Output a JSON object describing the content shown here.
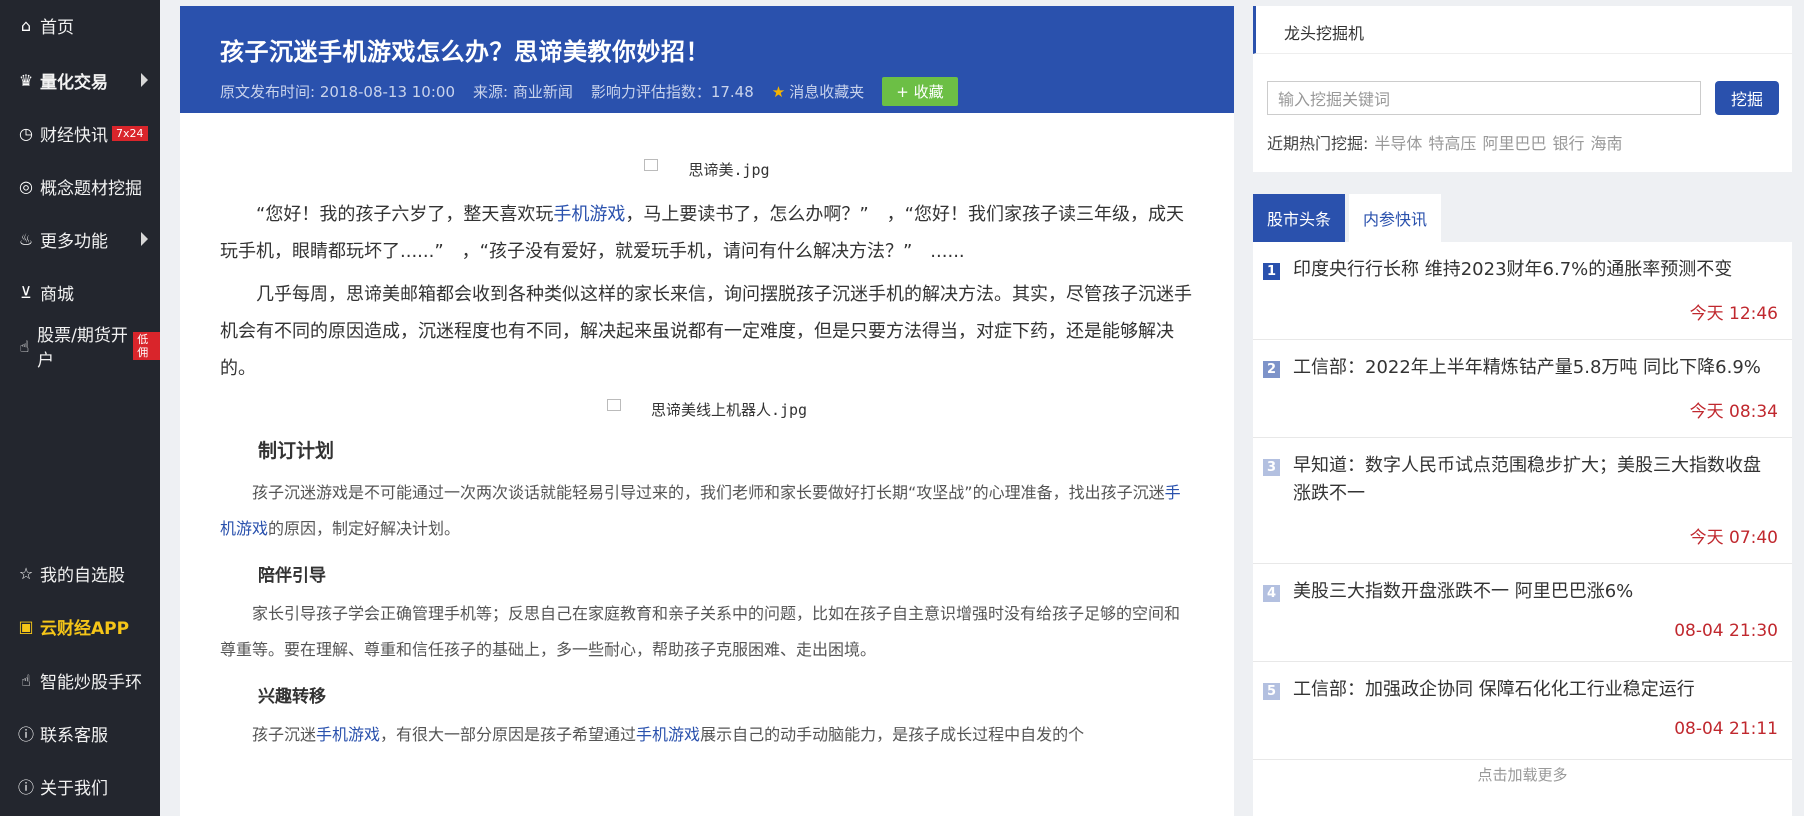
{
  "sidebar": {
    "items": [
      {
        "label": "首页",
        "icon": "home-icon",
        "glyph": "⌂"
      },
      {
        "label": "量化交易",
        "icon": "crown-icon",
        "glyph": "♛"
      },
      {
        "label": "财经快讯",
        "icon": "clock-icon",
        "glyph": "◷",
        "badge": "7x24"
      },
      {
        "label": "概念题材挖掘",
        "icon": "target-icon",
        "glyph": "◎"
      },
      {
        "label": "更多功能",
        "icon": "fire-icon",
        "glyph": "♨"
      },
      {
        "label": "商城",
        "icon": "cart-icon",
        "glyph": "⊻"
      },
      {
        "label": "股票/期货开户",
        "icon": "thumb-icon",
        "glyph": "☝",
        "badge": "低佣"
      },
      {
        "label": "我的自选股",
        "icon": "star-icon",
        "glyph": "☆"
      },
      {
        "label": "云财经APP",
        "icon": "app-icon",
        "glyph": "▣"
      },
      {
        "label": "智能炒股手环",
        "icon": "thumb-icon",
        "glyph": "☝"
      },
      {
        "label": "联系客服",
        "icon": "info-icon",
        "glyph": "ⓘ"
      },
      {
        "label": "关于我们",
        "icon": "info-icon",
        "glyph": "ⓘ"
      }
    ]
  },
  "article": {
    "title": "孩子沉迷手机游戏怎么办？思谛美教你妙招！",
    "publish_time": "原文发布时间: 2018-08-13 10:00",
    "source": "来源: 商业新闻",
    "influence": "影响力评估指数：17.48",
    "favorites_folder": "消息收藏夹",
    "collect_label": "+ 收藏",
    "img1_alt": "思谛美.jpg",
    "para1_a": "“您好！我的孩子六岁了，整天喜欢玩",
    "para1_link": "手机游戏",
    "para1_b": "，马上要读书了，怎么办啊？”　，“您好！我们家孩子读三年级，成天玩手机，眼睛都玩坏了......”　，“孩子没有爱好，就爱玩手机，请问有什么解决方法？”　......",
    "para2": "几乎每周，思谛美邮箱都会收到各种类似这样的家长来信，询问摆脱孩子沉迷手机的解决方法。其实，尽管孩子沉迷手机会有不同的原因造成，沉迷程度也有不同，解决起来虽说都有一定难度，但是只要方法得当，对症下药，还是能够解决的。",
    "img2_alt": "思谛美线上机器人.jpg",
    "h1": "制订计划",
    "para3_a": "孩子沉迷游戏是不可能通过一次两次谈话就能轻易引导过来的，我们老师和家长要做好打长期“攻坚战”的心理准备，找出孩子沉迷",
    "para3_link": "手机游戏",
    "para3_b": "的原因，制定好解决计划。",
    "h2": "陪伴引导",
    "para4": "家长引导孩子学会正确管理手机等；反思自己在家庭教育和亲子关系中的问题，比如在孩子自主意识增强时没有给孩子足够的空间和尊重等。要在理解、尊重和信任孩子的基础上，多一些耐心，帮助孩子克服困难、走出困境。",
    "h3": "兴趣转移",
    "para5_a": "孩子沉迷",
    "para5_link1": "手机游戏",
    "para5_b": "，有很大一部分原因是孩子希望通过",
    "para5_link2": "手机游戏",
    "para5_c": "展示自己的动手动脑能力，是孩子成长过程中自发的个"
  },
  "search": {
    "title": "龙头挖掘机",
    "placeholder": "输入挖掘关键词",
    "button": "挖掘",
    "hot_label": "近期热门挖掘:",
    "hot_keywords": [
      "半导体",
      "特高压",
      "阿里巴巴",
      "银行",
      "海南"
    ]
  },
  "news": {
    "tabs": [
      "股市头条",
      "内参快讯"
    ],
    "items": [
      {
        "num": "1",
        "title": "印度央行行长称 维持2023财年6.7%的通胀率预测不变",
        "time": "今天 12:46"
      },
      {
        "num": "2",
        "title": "工信部：2022年上半年精炼钴产量5.8万吨 同比下降6.9%",
        "time": "今天 08:34"
      },
      {
        "num": "3",
        "title": "早知道：数字人民币试点范围稳步扩大；美股三大指数收盘涨跌不一",
        "time": "今天 07:40"
      },
      {
        "num": "4",
        "title": "美股三大指数开盘涨跌不一 阿里巴巴涨6%",
        "time": "08-04 21:30"
      },
      {
        "num": "5",
        "title": "工信部：加强政企协同 保障石化化工行业稳定运行",
        "time": "08-04 21:11"
      }
    ],
    "more_label": "点击加载更多"
  },
  "colors": {
    "brand_blue": "#2a51ad",
    "sidebar_bg": "#23262e",
    "time_red": "#c0282e",
    "collect_green": "#6cbf45"
  }
}
